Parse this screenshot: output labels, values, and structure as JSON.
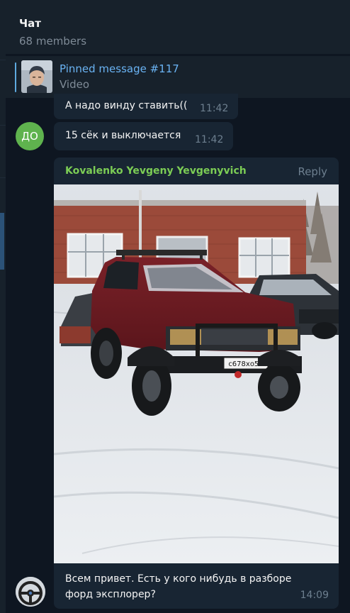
{
  "header": {
    "title": "Чат",
    "members": "68 members"
  },
  "pinned": {
    "title": "Pinned message #117",
    "subtitle": "Video"
  },
  "messages": [
    {
      "text": "А надо винду ставить((",
      "time": "11:42"
    },
    {
      "text": "15 сёк и выключается",
      "time": "11:42",
      "avatar_initials": "ДО",
      "avatar_color": "#5fb34e"
    }
  ],
  "photo_message": {
    "sender": "Kovalenko Yevgeny Yevgenyvich",
    "reply_label": "Reply",
    "plate": "с678хо55",
    "caption": "Всем привет. Есть у кого нибудь в разборе форд эксплорер?",
    "time": "14:09"
  },
  "colors": {
    "bg": "#0e1621",
    "panel": "#17212b",
    "bubble": "#182533",
    "link": "#6ab3f3",
    "sender": "#7ccd55",
    "muted": "#7f8b97"
  }
}
